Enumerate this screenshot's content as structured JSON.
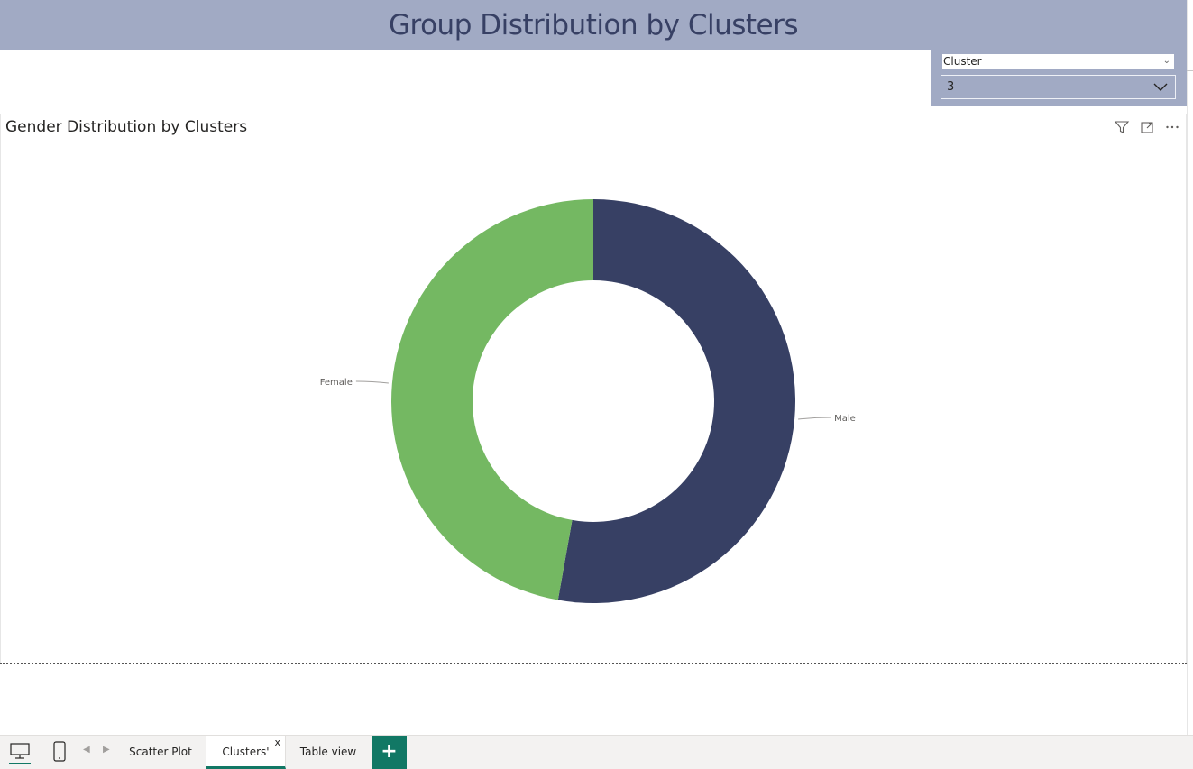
{
  "header": {
    "title": "Group Distribution by Clusters"
  },
  "slicer": {
    "field_label": "Cluster",
    "selected_value": "3"
  },
  "visual": {
    "title": "Gender Distribution by Clusters",
    "icons": [
      "filter-icon",
      "focus-mode-icon",
      "more-options-icon"
    ]
  },
  "chart_data": {
    "type": "pie",
    "variant": "donut",
    "title": "Gender Distribution by Clusters",
    "slices": [
      {
        "label": "Male",
        "value": 52.8,
        "color": "#374064"
      },
      {
        "label": "Female",
        "value": 47.2,
        "color": "#74b862"
      }
    ]
  },
  "tabs": {
    "items": [
      {
        "label": "Scatter Plot",
        "active": false
      },
      {
        "label": "Clusters'",
        "active": true
      },
      {
        "label": "Table view",
        "active": false
      }
    ],
    "close_glyph": "x",
    "add_glyph": "+"
  },
  "colors": {
    "banner": "#a1aac4",
    "title_text": "#374064",
    "accent": "#117865"
  }
}
